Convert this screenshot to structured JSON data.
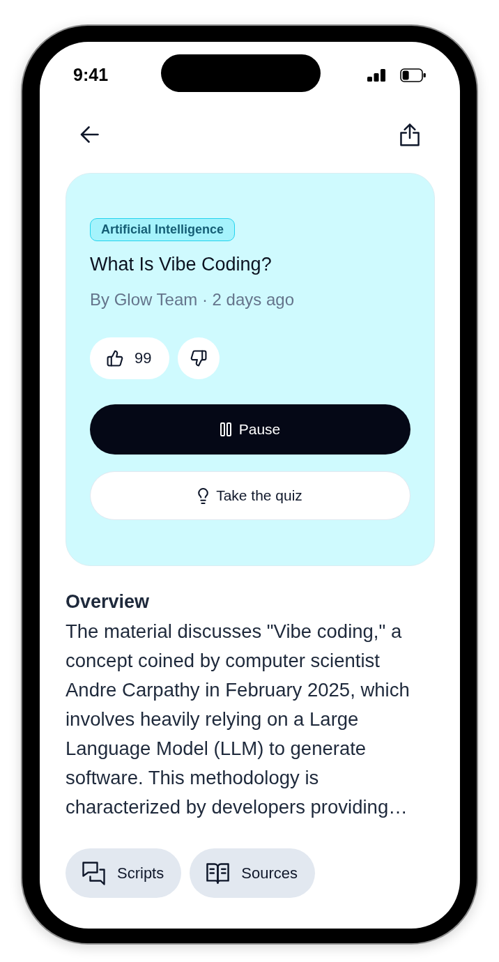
{
  "status_bar": {
    "time": "9:41"
  },
  "article": {
    "tag": "Artificial Intelligence",
    "title": "What Is Vibe Coding?",
    "byline": "By Glow Team · 2 days ago",
    "reactions": [
      {
        "kind": "like",
        "count": "99"
      },
      {
        "kind": "dislike"
      }
    ],
    "actions": [
      {
        "kind": "pause",
        "label": "Pause"
      },
      {
        "kind": "quiz",
        "label": "Take the quiz"
      }
    ]
  },
  "overview": {
    "heading": "Overview",
    "text": "The material discusses \"Vibe coding,\" a concept coined by computer scientist Andre Carpathy in February 2025, which involves heavily relying on a Large Language Model (LLM) to generate software. This methodology is characterized by developers providing…"
  },
  "links": [
    {
      "kind": "scripts",
      "label": "Scripts"
    },
    {
      "kind": "sources",
      "label": "Sources"
    }
  ]
}
